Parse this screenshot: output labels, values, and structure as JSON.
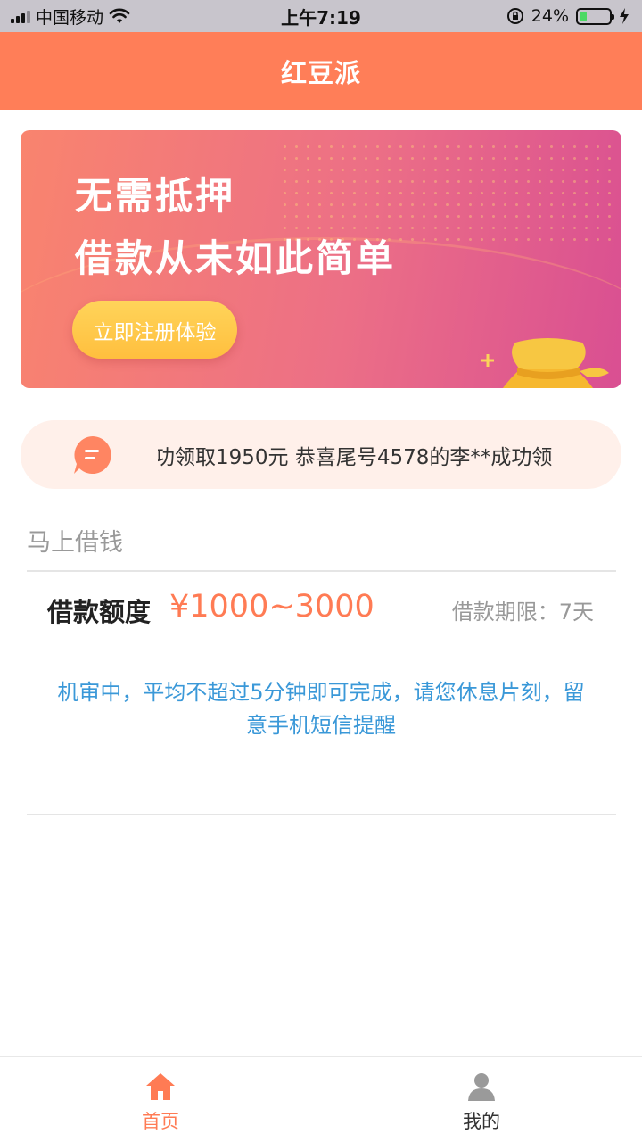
{
  "status_bar": {
    "carrier": "中国移动",
    "time": "上午7:19",
    "battery": "24%",
    "battery_level": 0.24
  },
  "nav": {
    "title": "红豆派"
  },
  "banner": {
    "line1": "无需抵押",
    "line2": "借款从未如此简单",
    "button": "立即注册体验",
    "coin_symbol": "¥"
  },
  "notice": {
    "text": "功领取1950元 恭喜尾号4578的李**成功领"
  },
  "loan": {
    "section_title": "马上借钱",
    "amount_label": "借款额度",
    "amount": "¥1000~3000",
    "term": "借款期限：7天",
    "tip": "机审中，平均不超过5分钟即可完成，请您休息片刻，留意手机短信提醒"
  },
  "tabs": [
    {
      "label": "首页",
      "icon": "home-icon",
      "active": true
    },
    {
      "label": "我的",
      "icon": "user-icon",
      "active": false
    }
  ],
  "colors": {
    "primary": "#ff7e58",
    "amount": "#ff7b54",
    "tip": "#3a98d8",
    "notice_bg": "#fff0ea"
  }
}
